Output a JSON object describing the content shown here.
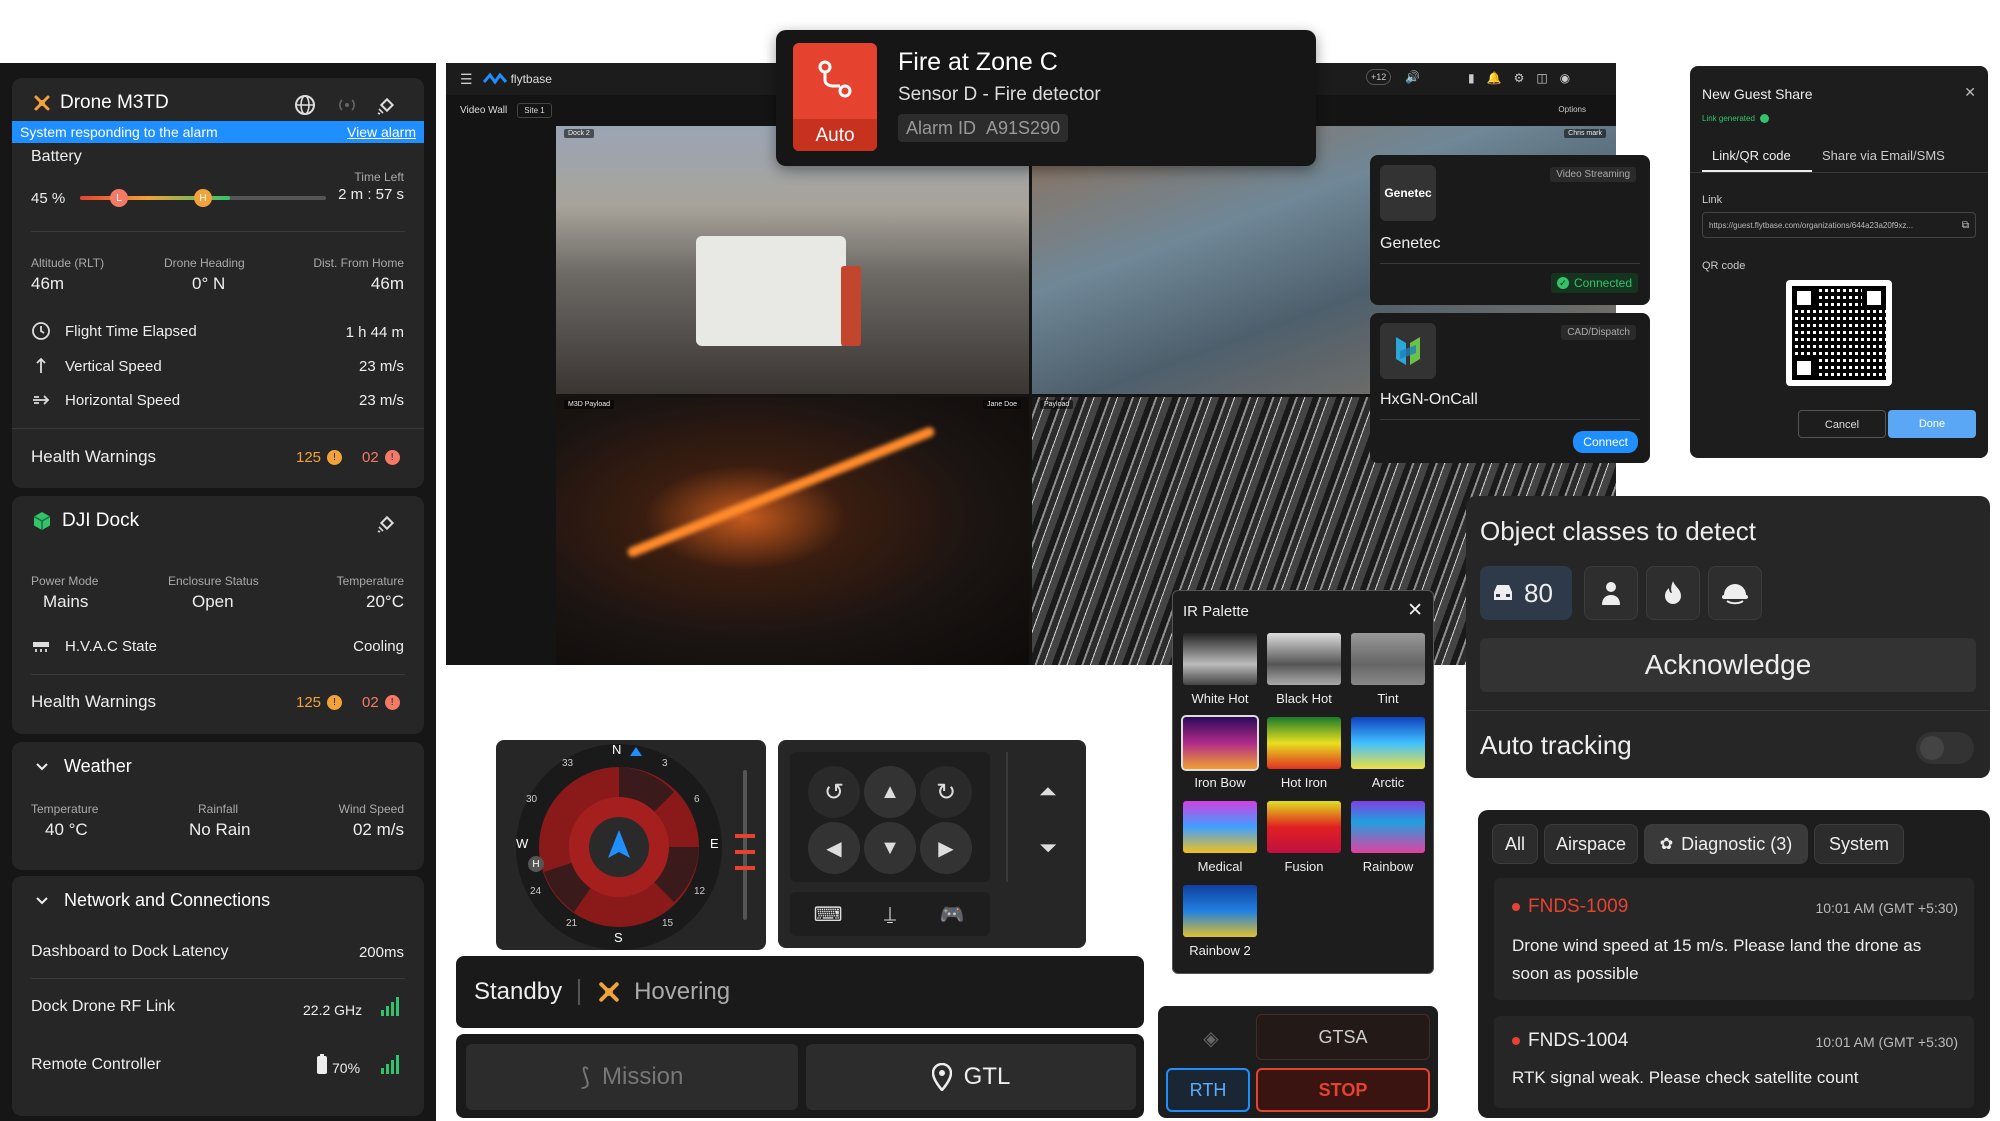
{
  "drone": {
    "name": "Drone M3TD",
    "alarm_msg": "System responding to the alarm",
    "view_alarm": "View alarm",
    "battery_label": "Battery",
    "battery_pct": "45 %",
    "battery_level": 0.45,
    "time_left_label": "Time Left",
    "time_left": "2 m : 57 s",
    "altitude_label": "Altitude (RLT)",
    "altitude": "46m",
    "heading_label": "Drone Heading",
    "heading": "0° N",
    "dist_label": "Dist. From Home",
    "dist": "46m",
    "flight_time_label": "Flight Time Elapsed",
    "flight_time": "1 h 44 m",
    "vspeed_label": "Vertical Speed",
    "vspeed": "23 m/s",
    "hspeed_label": "Horizontal Speed",
    "hspeed": "23 m/s",
    "health_label": "Health Warnings",
    "health_warn": "125",
    "health_err": "02"
  },
  "dock": {
    "name": "DJI Dock",
    "power_label": "Power Mode",
    "power": "Mains",
    "enclosure_label": "Enclosure Status",
    "enclosure": "Open",
    "temp_label": "Temperature",
    "temp": "20°C",
    "hvac_label": "H.V.A.C State",
    "hvac": "Cooling",
    "health_label": "Health Warnings",
    "health_warn": "125",
    "health_err": "02"
  },
  "weather": {
    "title": "Weather",
    "temp_label": "Temperature",
    "temp": "40 °C",
    "rain_label": "Rainfall",
    "rain": "No Rain",
    "wind_label": "Wind Speed",
    "wind": "02 m/s"
  },
  "network": {
    "title": "Network and Connections",
    "latency_label": "Dashboard to Dock Latency",
    "latency": "200ms",
    "rf_label": "Dock Drone RF Link",
    "rf": "22.2 GHz",
    "rc_label": "Remote Controller",
    "rc": "70%"
  },
  "app": {
    "brand": "flytbase",
    "video_wall": "Video Wall",
    "site": "Site 1",
    "options": "Options",
    "notif_count": "+12",
    "tile_labels": [
      "Dock 2",
      "Chris mark",
      "M3D Payload",
      "Jane Doe",
      "Payload"
    ]
  },
  "alert": {
    "title": "Fire at Zone C",
    "subtitle": "Sensor D - Fire detector",
    "alarm_id_label": "Alarm ID",
    "alarm_id": "A91S290",
    "mode": "Auto"
  },
  "integrations": {
    "genetec_tag": "Video Streaming",
    "genetec_logo": "Genetec",
    "genetec_name": "Genetec",
    "genetec_status": "Connected",
    "hxgn_tag": "CAD/Dispatch",
    "hxgn_name": "HxGN-OnCall",
    "hxgn_btn": "Connect"
  },
  "share": {
    "title": "New Guest Share",
    "link_generated": "Link generated",
    "tab1": "Link/QR code",
    "tab2": "Share via Email/SMS",
    "link_label": "Link",
    "link": "https://guest.flytbase.com/organizations/644a23a20f9xz...",
    "qr_label": "QR code",
    "cancel": "Cancel",
    "done": "Done"
  },
  "objects": {
    "title": "Object classes to detect",
    "vehicle_count": "80",
    "acknowledge": "Acknowledge",
    "auto_tracking": "Auto tracking"
  },
  "palette": {
    "title": "IR Palette",
    "items": [
      "White Hot",
      "Black Hot",
      "Tint",
      "Iron Bow",
      "Hot Iron",
      "Arctic",
      "Medical",
      "Fusion",
      "Rainbow",
      "Rainbow 2"
    ]
  },
  "compass": {
    "n": "N",
    "e": "E",
    "s": "S",
    "w": "W",
    "t3": "3",
    "t6": "6",
    "t12": "12",
    "t15": "15",
    "t21": "21",
    "t24": "24",
    "t30": "30",
    "t33": "33",
    "home": "H"
  },
  "status": {
    "standby": "Standby",
    "hovering": "Hovering",
    "mission": "Mission",
    "gtl": "GTL",
    "gtsa": "GTSA",
    "rth": "RTH",
    "stop": "STOP"
  },
  "alerts": {
    "tabs": [
      "All",
      "Airspace",
      "Diagnostic (3)",
      "System"
    ],
    "items": [
      {
        "code": "FNDS-1009",
        "time": "10:01 AM (GMT +5:30)",
        "msg": "Drone wind speed at 15 m/s. Please land the drone as soon as possible"
      },
      {
        "code": "FNDS-1004",
        "time": "10:01 AM (GMT +5:30)",
        "msg": "RTK signal weak. Please check satellite count"
      }
    ]
  },
  "colors": {
    "accent_blue": "#1f8fff",
    "alert_red": "#e5432f",
    "ok_green": "#33c46b",
    "warn_orange": "#f2a23a"
  },
  "icons": [
    "drone-icon",
    "globe-icon",
    "signal-icon",
    "satellite-icon",
    "dock-icon",
    "clock-icon",
    "arrow-up-icon",
    "arrow-right-icon",
    "hvac-icon",
    "chevron-down-icon",
    "wifi-bars-icon",
    "battery-icon",
    "close-icon",
    "copy-icon",
    "car-icon",
    "person-icon",
    "fire-icon",
    "helmet-icon",
    "rotate-left-icon",
    "rotate-right-icon",
    "keyboard-icon",
    "joystick-icon",
    "gamepad-icon",
    "mission-icon",
    "location-icon"
  ]
}
